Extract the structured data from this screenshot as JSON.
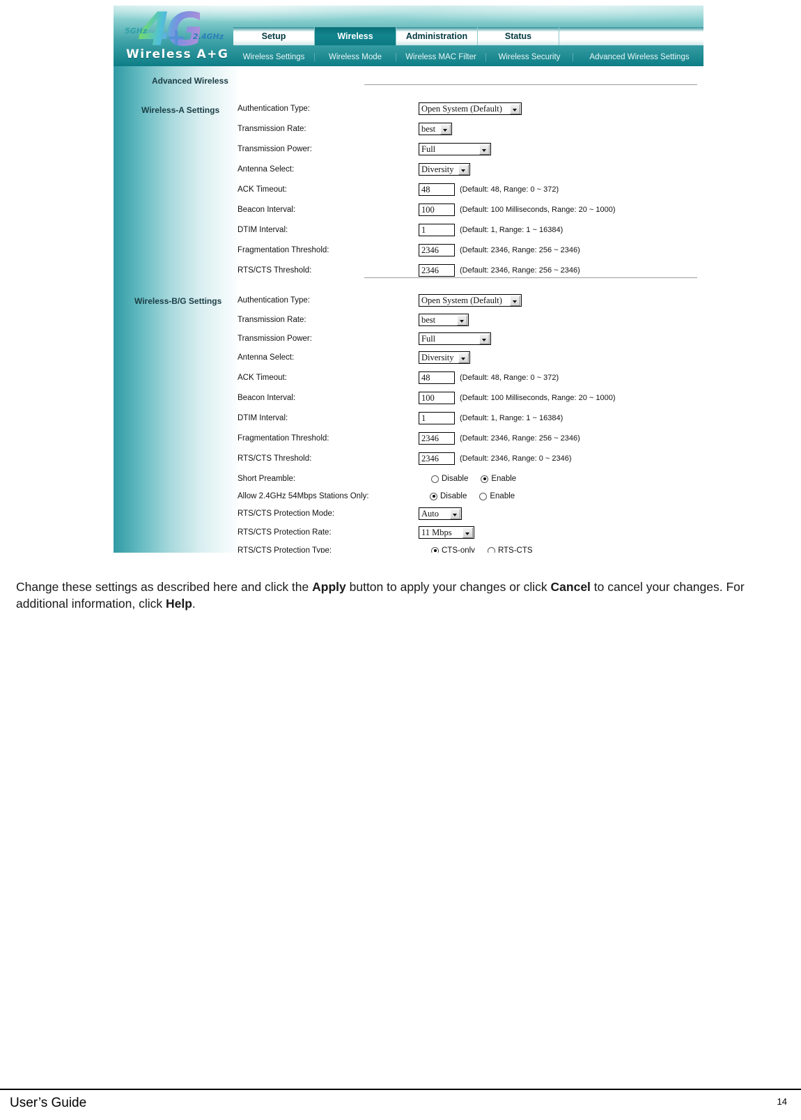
{
  "router": {
    "logo": {
      "mark": "4G",
      "plus": "+",
      "band_left": "5GHz",
      "band_right": "2.4GHz",
      "wordmark": "Wireless A+G"
    },
    "tabs": [
      {
        "label": "Setup",
        "active": false
      },
      {
        "label": "Wireless",
        "active": true
      },
      {
        "label": "Administration",
        "active": false
      },
      {
        "label": "Status",
        "active": false
      }
    ],
    "subtabs": [
      "Wireless Settings",
      "Wireless Mode",
      "Wireless MAC Filter",
      "Wireless Security",
      "Advanced Wireless Settings"
    ],
    "section_title": "Advanced Wireless",
    "groups": {
      "a": {
        "side_label": "Wireless-A Settings",
        "rows": [
          {
            "label": "Authentication Type:",
            "control": "select",
            "value": "Open System (Default)",
            "hint": ""
          },
          {
            "label": "Transmission Rate:",
            "control": "select",
            "value": "best",
            "hint": ""
          },
          {
            "label": "Transmission Power:",
            "control": "select",
            "value": "Full",
            "hint": ""
          },
          {
            "label": "Antenna Select:",
            "control": "select",
            "value": "Diversity",
            "hint": ""
          },
          {
            "label": "ACK Timeout:",
            "control": "text",
            "value": "48",
            "hint": "(Default: 48, Range: 0 ~ 372)"
          },
          {
            "label": "Beacon Interval:",
            "control": "text",
            "value": "100",
            "hint": "(Default: 100 Milliseconds, Range: 20 ~ 1000)"
          },
          {
            "label": "DTIM Interval:",
            "control": "text",
            "value": "1",
            "hint": "(Default: 1, Range: 1 ~ 16384)"
          },
          {
            "label": "Fragmentation Threshold:",
            "control": "text",
            "value": "2346",
            "hint": "(Default: 2346, Range: 256 ~ 2346)"
          },
          {
            "label": "RTS/CTS Threshold:",
            "control": "text",
            "value": "2346",
            "hint": "(Default: 2346, Range: 256 ~ 2346)"
          }
        ]
      },
      "bg": {
        "side_label": "Wireless-B/G Settings",
        "rows": [
          {
            "label": "Authentication Type:",
            "control": "select",
            "value": "Open System (Default)",
            "hint": ""
          },
          {
            "label": "Transmission Rate:",
            "control": "select",
            "value": "best",
            "hint": ""
          },
          {
            "label": "Transmission Power:",
            "control": "select",
            "value": "Full",
            "hint": ""
          },
          {
            "label": "Antenna Select:",
            "control": "select",
            "value": "Diversity",
            "hint": ""
          },
          {
            "label": "ACK Timeout:",
            "control": "text",
            "value": "48",
            "hint": "(Default: 48, Range: 0 ~ 372)"
          },
          {
            "label": "Beacon Interval:",
            "control": "text",
            "value": "100",
            "hint": "(Default: 100 Milliseconds, Range: 20 ~ 1000)"
          },
          {
            "label": "DTIM Interval:",
            "control": "text",
            "value": "1",
            "hint": "(Default: 1, Range: 1 ~ 16384)"
          },
          {
            "label": "Fragmentation Threshold:",
            "control": "text",
            "value": "2346",
            "hint": "(Default: 2346, Range: 256 ~ 2346)"
          },
          {
            "label": "RTS/CTS Threshold:",
            "control": "text",
            "value": "2346",
            "hint": "(Default: 2346, Range: 0 ~ 2346)"
          },
          {
            "label": "Short Preamble:",
            "control": "radio",
            "options": [
              "Disable",
              "Enable"
            ],
            "selected": "Enable"
          },
          {
            "label": "Allow 2.4GHz 54Mbps Stations Only:",
            "control": "radio",
            "options": [
              "Disable",
              "Enable"
            ],
            "selected": "Disable"
          },
          {
            "label": "RTS/CTS Protection Mode:",
            "control": "select",
            "value": "Auto",
            "hint": ""
          },
          {
            "label": "RTS/CTS Protection Rate:",
            "control": "select",
            "value": "11 Mbps",
            "hint": ""
          },
          {
            "label": "RTS/CTS Protection Type:",
            "control": "radio",
            "options": [
              "CTS-only",
              "RTS-CTS"
            ],
            "selected": "CTS-only"
          }
        ]
      }
    }
  },
  "caption": {
    "part1": "Change these settings as described here and click the ",
    "bold1": "Apply",
    "part2": " button to apply your changes or click ",
    "bold2": "Cancel",
    "part3": " to cancel your changes. For additional information, click ",
    "bold3": "Help",
    "part4": "."
  },
  "footer": {
    "left": "User’s Guide",
    "page": "14"
  },
  "colors": {
    "teal_dark": "#0d7d86",
    "teal_mid": "#3fa3a8",
    "teal_light": "#a8d9dd",
    "text": "#111111"
  }
}
